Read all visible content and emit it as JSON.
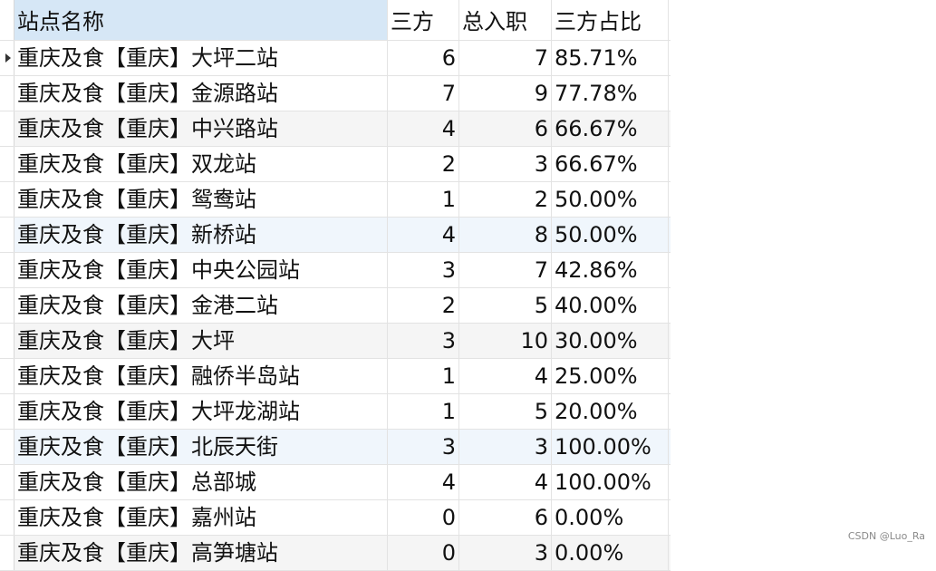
{
  "table": {
    "columns": [
      "站点名称",
      "三方",
      "总入职",
      "三方占比"
    ],
    "rows": [
      {
        "name": "重庆及食【重庆】大坪二站",
        "third": "6",
        "total": "7",
        "ratio": "85.71%"
      },
      {
        "name": "重庆及食【重庆】金源路站",
        "third": "7",
        "total": "9",
        "ratio": "77.78%"
      },
      {
        "name": "重庆及食【重庆】中兴路站",
        "third": "4",
        "total": "6",
        "ratio": "66.67%"
      },
      {
        "name": "重庆及食【重庆】双龙站",
        "third": "2",
        "total": "3",
        "ratio": "66.67%"
      },
      {
        "name": "重庆及食【重庆】鸳鸯站",
        "third": "1",
        "total": "2",
        "ratio": "50.00%"
      },
      {
        "name": "重庆及食【重庆】新桥站",
        "third": "4",
        "total": "8",
        "ratio": "50.00%"
      },
      {
        "name": "重庆及食【重庆】中央公园站",
        "third": "3",
        "total": "7",
        "ratio": "42.86%"
      },
      {
        "name": "重庆及食【重庆】金港二站",
        "third": "2",
        "total": "5",
        "ratio": "40.00%"
      },
      {
        "name": "重庆及食【重庆】大坪",
        "third": "3",
        "total": "10",
        "ratio": "30.00%"
      },
      {
        "name": "重庆及食【重庆】融侨半岛站",
        "third": "1",
        "total": "4",
        "ratio": "25.00%"
      },
      {
        "name": "重庆及食【重庆】大坪龙湖站",
        "third": "1",
        "total": "5",
        "ratio": "20.00%"
      },
      {
        "name": "重庆及食【重庆】北辰天街",
        "third": "3",
        "total": "3",
        "ratio": "100.00%"
      },
      {
        "name": "重庆及食【重庆】总部城",
        "third": "4",
        "total": "4",
        "ratio": "100.00%"
      },
      {
        "name": "重庆及食【重庆】嘉州站",
        "third": "0",
        "total": "6",
        "ratio": "0.00%"
      },
      {
        "name": "重庆及食【重庆】高笋塘站",
        "third": "0",
        "total": "3",
        "ratio": "0.00%"
      }
    ]
  },
  "watermark": "CSDN @Luo_Ra"
}
